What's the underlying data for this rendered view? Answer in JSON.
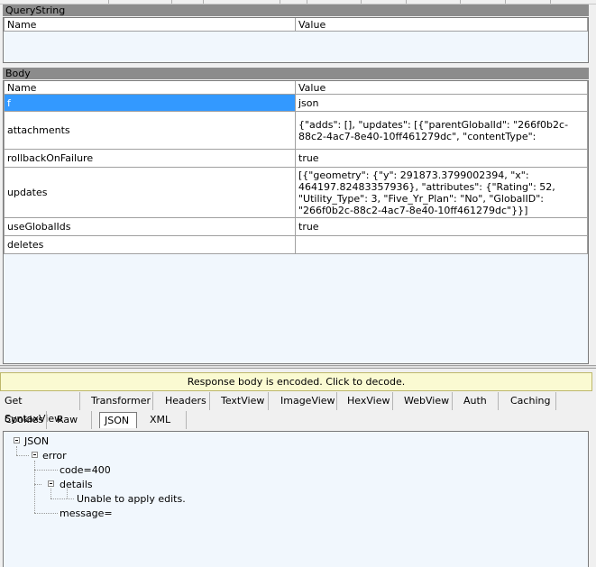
{
  "querystring": {
    "title": "QueryString",
    "columns": [
      "Name",
      "Value"
    ]
  },
  "body": {
    "title": "Body",
    "columns": [
      "Name",
      "Value"
    ],
    "rows": [
      {
        "name": "f",
        "value": "json"
      },
      {
        "name": "attachments",
        "value": "{\"adds\": [], \"updates\": [{\"parentGlobalId\": \"266f0b2c-88c2-4ac7-8e40-10ff461279dc\", \"contentType\":"
      },
      {
        "name": "rollbackOnFailure",
        "value": "true"
      },
      {
        "name": "updates",
        "value": "[{\"geometry\": {\"y\": 291873.3799002394, \"x\": 464197.82483357936}, \"attributes\": {\"Rating\": 52, \"Utility_Type\": 3, \"Five_Yr_Plan\": \"No\", \"GlobalID\": \"266f0b2c-88c2-4ac7-8e40-10ff461279dc\"}}]"
      },
      {
        "name": "useGlobalIds",
        "value": "true"
      },
      {
        "name": "deletes",
        "value": ""
      }
    ]
  },
  "encoded_notice": "Response body is encoded. Click to decode.",
  "tabs_row1": [
    "Get SyntaxView",
    "Transformer",
    "Headers",
    "TextView",
    "ImageView",
    "HexView",
    "WebView",
    "Auth",
    "Caching"
  ],
  "tabs_row2": [
    "Cookies",
    "Raw",
    "JSON",
    "XML"
  ],
  "active_tab": "JSON",
  "tree": {
    "root": "JSON",
    "error": "error",
    "code": "code=400",
    "details": "details",
    "detail_item": "Unable to apply edits.",
    "message": "message="
  }
}
